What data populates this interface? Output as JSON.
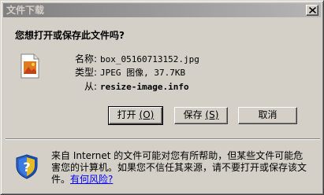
{
  "window": {
    "title": "文件下载"
  },
  "dialog": {
    "question": "您想打开或保存此文件吗?",
    "file": {
      "name_label": "名称:",
      "name_value": "box_05160713152.jpg",
      "type_label": "类型:",
      "type_value": "JPEG 图像, 37.7KB",
      "from_label": "从:",
      "from_value": "resize-image.info"
    },
    "buttons": {
      "open_label": "打开",
      "open_accel": "(O)",
      "save_label": "保存",
      "save_accel": "(S)",
      "cancel_label": "取消"
    },
    "warning": {
      "text": "来自 Internet 的文件可能对您有所帮助，但某些文件可能危害您的计算机。如果您不信任其来源，请不要打开或保存该文件。",
      "link": "有何风险?"
    }
  },
  "icons": {
    "close": "close-icon",
    "file": "jpeg-file-icon",
    "shield": "security-shield-icon"
  }
}
